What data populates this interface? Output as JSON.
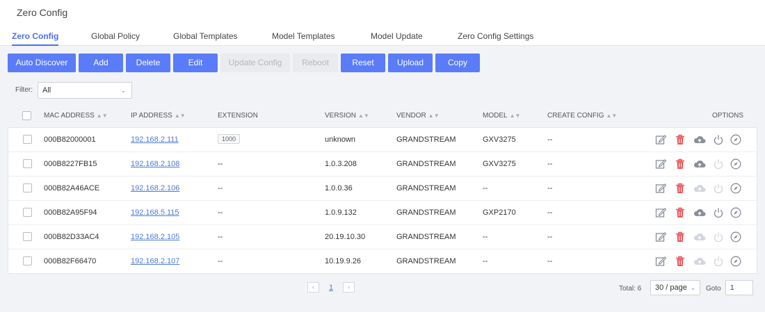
{
  "header": {
    "title": "Zero Config"
  },
  "tabs": [
    {
      "label": "Zero Config",
      "active": true
    },
    {
      "label": "Global Policy"
    },
    {
      "label": "Global Templates"
    },
    {
      "label": "Model Templates"
    },
    {
      "label": "Model Update"
    },
    {
      "label": "Zero Config Settings"
    }
  ],
  "toolbar": {
    "auto_discover": "Auto Discover",
    "add": "Add",
    "delete": "Delete",
    "edit": "Edit",
    "update_config": "Update Config",
    "reboot": "Reboot",
    "reset": "Reset",
    "upload": "Upload",
    "copy": "Copy"
  },
  "filter": {
    "label": "Filter:",
    "value": "All"
  },
  "table": {
    "columns": {
      "mac": "MAC ADDRESS",
      "ip": "IP ADDRESS",
      "extension": "EXTENSION",
      "version": "VERSION",
      "vendor": "VENDOR",
      "model": "MODEL",
      "create_config": "CREATE CONFIG",
      "options": "OPTIONS"
    },
    "rows": [
      {
        "mac": "000B82000001",
        "ip": "192.168.2.111",
        "extension": "1000",
        "version": "unknown",
        "vendor": "GRANDSTREAM",
        "model": "GXV3275",
        "create_config": "--"
      },
      {
        "mac": "000B8227FB15",
        "ip": "192.168.2.108",
        "extension": "--",
        "version": "1.0.3.208",
        "vendor": "GRANDSTREAM",
        "model": "GXV3275",
        "create_config": "--"
      },
      {
        "mac": "000B82A46ACE",
        "ip": "192.168.2.106",
        "extension": "--",
        "version": "1.0.0.36",
        "vendor": "GRANDSTREAM",
        "model": "--",
        "create_config": "--"
      },
      {
        "mac": "000B82A95F94",
        "ip": "192.168.5.115",
        "extension": "--",
        "version": "1.0.9.132",
        "vendor": "GRANDSTREAM",
        "model": "GXP2170",
        "create_config": "--"
      },
      {
        "mac": "000B82D33AC4",
        "ip": "192.168.2.105",
        "extension": "--",
        "version": "20.19.10.30",
        "vendor": "GRANDSTREAM",
        "model": "--",
        "create_config": "--"
      },
      {
        "mac": "000B82F66470",
        "ip": "192.168.2.107",
        "extension": "--",
        "version": "10.19.9.26",
        "vendor": "GRANDSTREAM",
        "model": "--",
        "create_config": "--"
      }
    ]
  },
  "pagination": {
    "current_page": "1",
    "total_label": "Total: 6",
    "page_size": "30 / page",
    "goto_label": "Goto",
    "goto_value": "1"
  },
  "colors": {
    "accent": "#5a7cf8",
    "delete_icon": "#e8565a",
    "icon_active": "#8a8f99",
    "icon_disabled": "#d3d6db"
  }
}
